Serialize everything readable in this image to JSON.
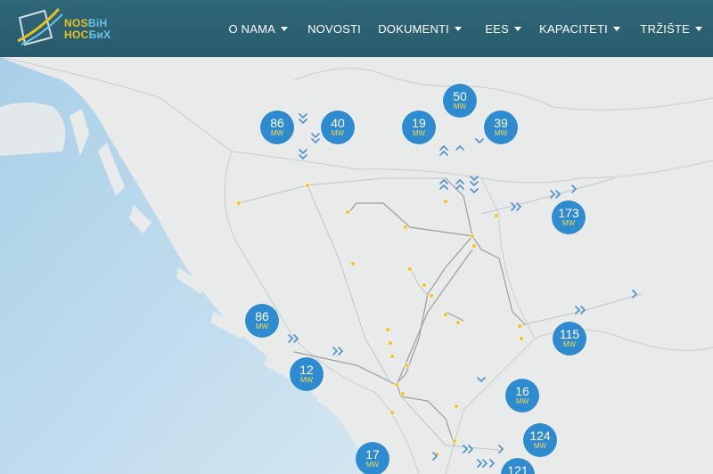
{
  "header": {
    "logo": {
      "line1_a": "NOS",
      "line1_b": "BiH",
      "line2_a": "НОС",
      "line2_b": "БиХ"
    },
    "nav": [
      {
        "label": "O NAMA",
        "dropdown": true
      },
      {
        "label": "NOVOSTI",
        "dropdown": false
      },
      {
        "label": "DOKUMENTI",
        "dropdown": true
      },
      {
        "label": "EES",
        "dropdown": true
      },
      {
        "label": "KAPACITETI",
        "dropdown": true
      },
      {
        "label": "TRŽIŠTE",
        "dropdown": true
      }
    ]
  },
  "map": {
    "unit": "MW",
    "bubbles": [
      {
        "value": "86"
      },
      {
        "value": "40"
      },
      {
        "value": "19"
      },
      {
        "value": "50"
      },
      {
        "value": "39"
      },
      {
        "value": "173"
      },
      {
        "value": "86"
      },
      {
        "value": "115"
      },
      {
        "value": "12"
      },
      {
        "value": "16"
      },
      {
        "value": "124"
      },
      {
        "value": "17"
      },
      {
        "value": "121"
      }
    ]
  },
  "colors": {
    "header": "#2f6778",
    "bubble": "#2f8bd0",
    "unit_text": "#f6d74d",
    "sea": "#b8d9ec",
    "node": "#f2c43a",
    "arrow": "#4a93d1"
  }
}
